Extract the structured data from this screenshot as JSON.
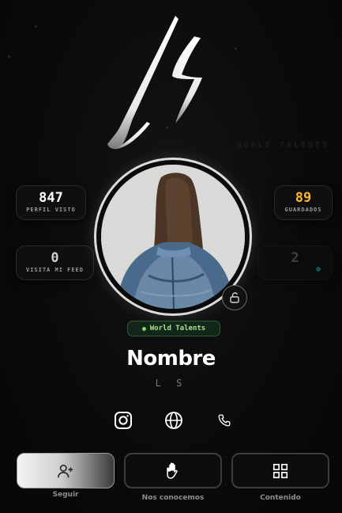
{
  "logo": {
    "text": "LS"
  },
  "ghost_text": "WORLD TALENTS",
  "stats": {
    "profile_views": {
      "value": "847",
      "label": "PERFIL VISTO"
    },
    "feed_visits": {
      "value": "0",
      "label": "VISITA MI FEED"
    },
    "saved": {
      "value": "89",
      "label": "GUARDADOS"
    },
    "faded": {
      "value": "2",
      "label": ""
    }
  },
  "badge": {
    "text": "World Talents"
  },
  "profile": {
    "name": "Nombre",
    "handle": "L S"
  },
  "social": [
    "instagram-icon",
    "globe-icon",
    "phone-icon"
  ],
  "actions": [
    {
      "label": "Seguir",
      "icon": "add-user-icon"
    },
    {
      "label": "Nos conocemos",
      "icon": "hand-icon"
    },
    {
      "label": "Contenido",
      "icon": "grid-icon"
    }
  ],
  "colors": {
    "accent_gold": "#f5b82e",
    "badge_green": "#7dd96b",
    "teal": "#2bd4c0"
  }
}
